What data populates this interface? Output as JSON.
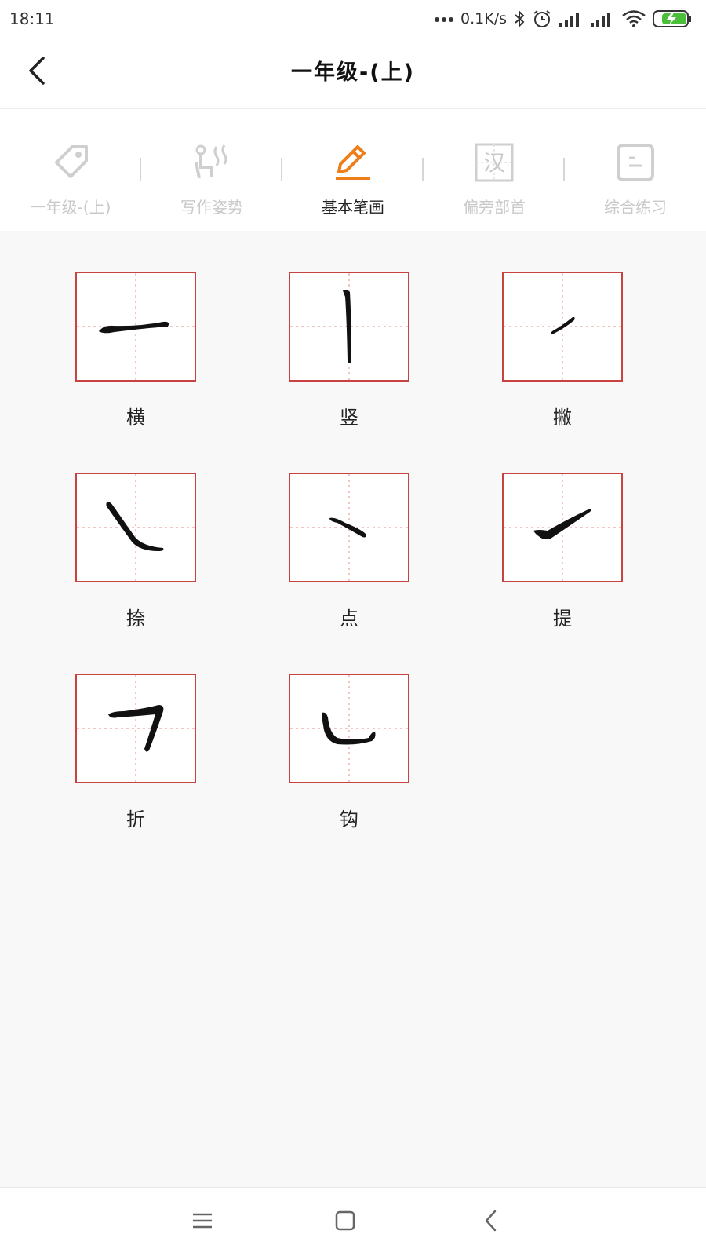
{
  "status_bar": {
    "time": "18:11",
    "net_speed": "0.1K/s",
    "icons": [
      "more-dots-icon",
      "bluetooth-icon",
      "alarm-icon",
      "signal-icon",
      "signal-icon",
      "wifi-icon",
      "battery-charging-icon"
    ]
  },
  "header": {
    "back_icon": "back-arrow-icon",
    "title": "一年级-(上)"
  },
  "tabs": [
    {
      "label": "一年级-(上)",
      "icon": "tag-icon",
      "active": false
    },
    {
      "label": "写作姿势",
      "icon": "writing-posture-icon",
      "active": false
    },
    {
      "label": "基本笔画",
      "icon": "pencil-icon",
      "active": true
    },
    {
      "label": "偏旁部首",
      "icon": "radical-han-icon",
      "active": false
    },
    {
      "label": "综合练习",
      "icon": "practice-icon",
      "active": false
    }
  ],
  "strokes": [
    {
      "label": "横",
      "icon": "stroke-heng-icon"
    },
    {
      "label": "竖",
      "icon": "stroke-shu-icon"
    },
    {
      "label": "撇",
      "icon": "stroke-pie-icon"
    },
    {
      "label": "捺",
      "icon": "stroke-na-icon"
    },
    {
      "label": "点",
      "icon": "stroke-dian-icon"
    },
    {
      "label": "提",
      "icon": "stroke-ti-icon"
    },
    {
      "label": "折",
      "icon": "stroke-zhe-icon"
    },
    {
      "label": "钩",
      "icon": "stroke-gou-icon"
    }
  ],
  "nav_bar": {
    "icons": [
      "menu-icon",
      "home-square-icon",
      "back-chevron-icon"
    ]
  },
  "colors": {
    "accent": "#ef7d1a",
    "grid_border": "#c8433f",
    "grid_guide": "#e9a7a4",
    "inactive": "#c9c9c9"
  }
}
